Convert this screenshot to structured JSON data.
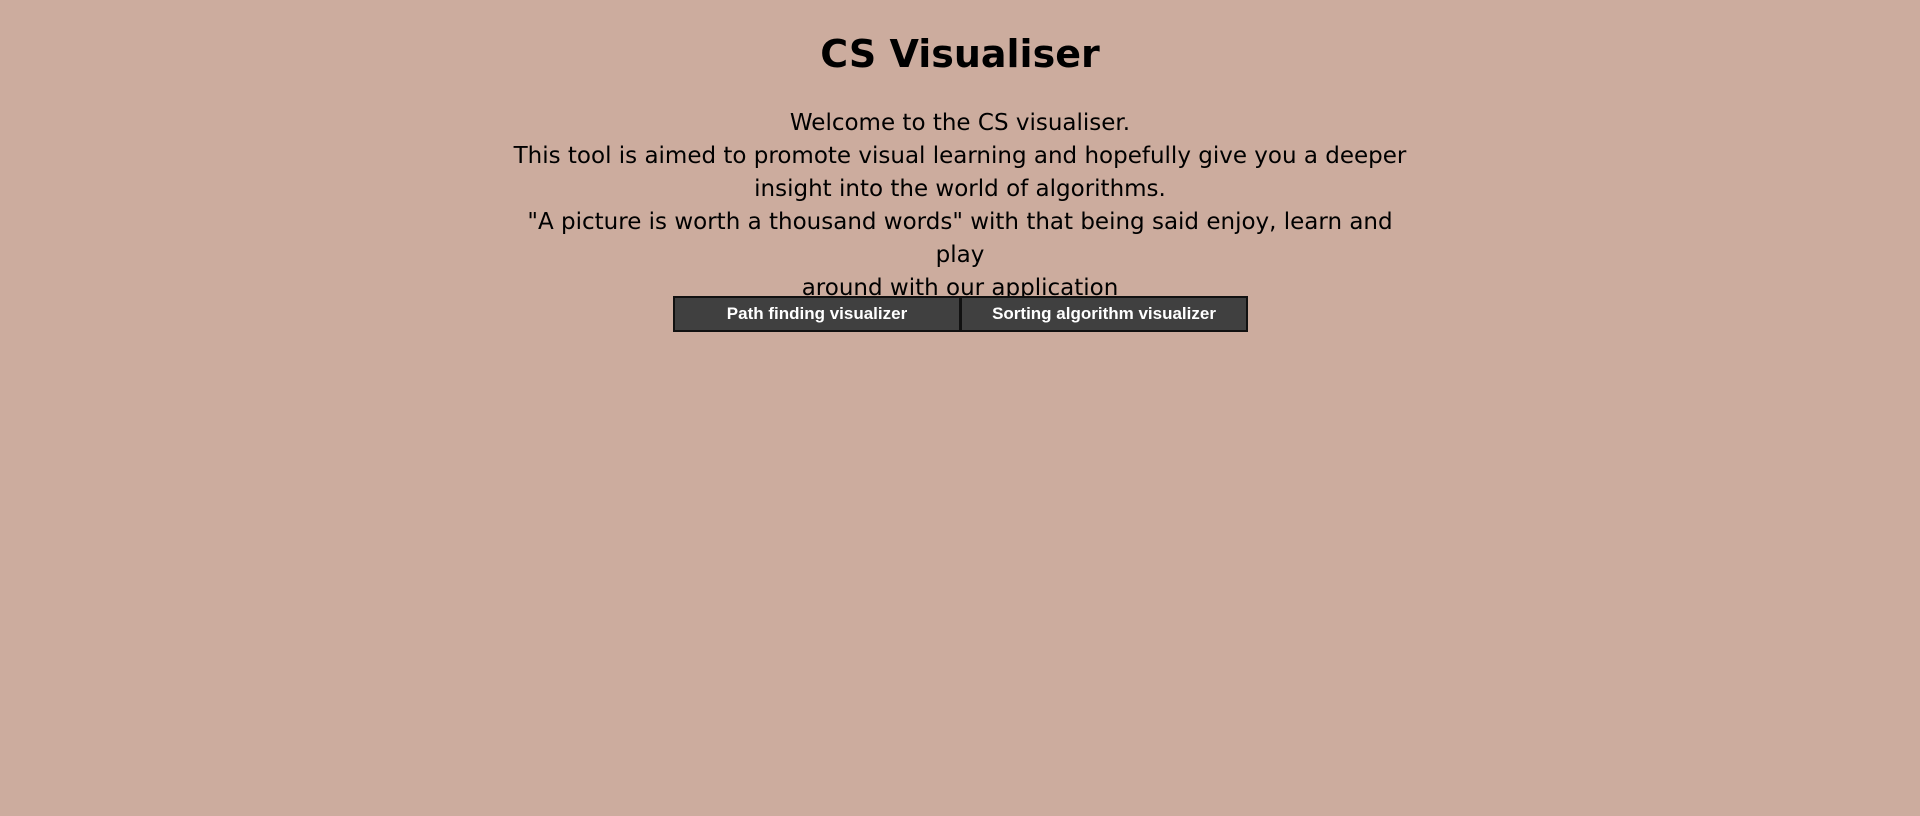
{
  "header": {
    "title": "CS Visualiser"
  },
  "intro": {
    "lines": [
      "Welcome to the CS visualiser.",
      "This tool is aimed to promote visual learning and hopefully give you a deeper",
      "insight into the world of algorithms.",
      "\"A picture is worth a thousand words\" with that being said enjoy, learn and play",
      "around with our application"
    ]
  },
  "nav": {
    "path_finding_label": "Path finding visualizer",
    "sorting_label": "Sorting algorithm visualizer"
  },
  "colors": {
    "background": "#ccac9e",
    "button_bg": "#404040",
    "button_text": "#ffffff"
  }
}
